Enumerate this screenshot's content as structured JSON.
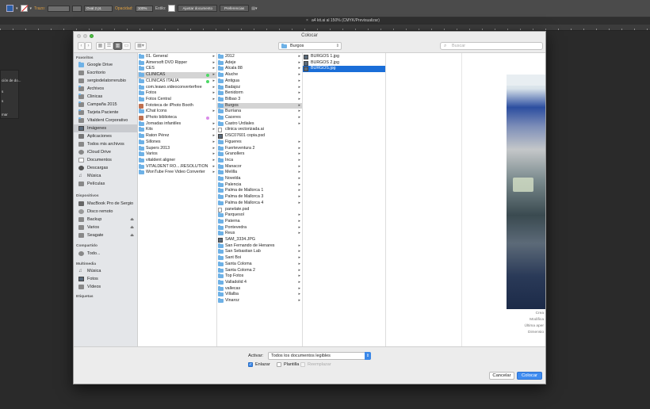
{
  "app_toolbar": {
    "trazo_label": "Trazo:",
    "stroke_profile": "Oval 2 pt.",
    "opacidad_label": "Opacidad:",
    "opacidad_value": "100%",
    "estilo_label": "Estilo:",
    "ajustar_documento": "Ajustar documento",
    "preferencias": "Preferencias"
  },
  "app_window": {
    "doc_tab_title": "a4 kit.ai al 150% (CMYK/Previsualizar)"
  },
  "left_panel": {
    "items": [
      "ción de do...",
      "s",
      "s",
      "mar"
    ]
  },
  "dialog": {
    "title": "Colocar",
    "location": "Burgos",
    "search_placeholder": "Buscar"
  },
  "sidebar": {
    "favoritos_header": "Favoritos",
    "favoritos": [
      {
        "label": "Google Drive",
        "icon": "google-drive-icon"
      },
      {
        "label": "Escritorio",
        "icon": "desktop-icon"
      },
      {
        "label": "sergiodelatorrerubio",
        "icon": "home-icon"
      },
      {
        "label": "Archivos",
        "icon": "folder-icon"
      },
      {
        "label": "Clinicas",
        "icon": "folder-icon"
      },
      {
        "label": "Campaña 2015",
        "icon": "folder-icon"
      },
      {
        "label": "Tarjeta Paciente",
        "icon": "folder-icon"
      },
      {
        "label": "Vitaldent Corporativo",
        "icon": "folder-icon"
      },
      {
        "label": "Imágenes",
        "icon": "pictures-icon"
      },
      {
        "label": "Aplicaciones",
        "icon": "applications-icon"
      },
      {
        "label": "Todos mis archivos",
        "icon": "all-files-icon"
      },
      {
        "label": "iCloud Drive",
        "icon": "cloud-icon"
      },
      {
        "label": "Documentos",
        "icon": "documents-icon"
      },
      {
        "label": "Descargas",
        "icon": "downloads-icon"
      },
      {
        "label": "Música",
        "icon": "music-icon"
      },
      {
        "label": "Películas",
        "icon": "movies-icon"
      }
    ],
    "dispositivos_header": "Dispositivos",
    "dispositivos": [
      {
        "label": "MacBook Pro de Sergio",
        "icon": "laptop-icon"
      },
      {
        "label": "Disco remoto",
        "icon": "disc-icon"
      },
      {
        "label": "Backup",
        "icon": "drive-icon",
        "eject": "⏏"
      },
      {
        "label": "Varios",
        "icon": "drive-icon",
        "eject": "⏏"
      },
      {
        "label": "Seagate",
        "icon": "drive-icon",
        "eject": "⏏"
      }
    ],
    "compartido_header": "Compartido",
    "compartido": [
      {
        "label": "Todo...",
        "icon": "network-icon"
      }
    ],
    "multimedia_header": "Multimedia",
    "multimedia": [
      {
        "label": "Música",
        "icon": "music-icon"
      },
      {
        "label": "Fotos",
        "icon": "photos-icon"
      },
      {
        "label": "Vídeos",
        "icon": "movies-icon"
      }
    ],
    "etiquetas_header": "Etiquetas"
  },
  "column1": [
    {
      "label": "01. General",
      "type": "folder",
      "arrow": true
    },
    {
      "label": "Aimersoft DVD Ripper",
      "type": "folder",
      "arrow": true
    },
    {
      "label": "CES",
      "type": "folder",
      "arrow": true
    },
    {
      "label": "CLINICAS",
      "type": "folder",
      "arrow": true,
      "tag": "#4cd964",
      "selected": true
    },
    {
      "label": "CLINICAS ITALIA",
      "type": "folder",
      "arrow": true,
      "tag": "#4cd964"
    },
    {
      "label": "com.leawo.videoconverterfree",
      "type": "folder",
      "arrow": true
    },
    {
      "label": "Fotos",
      "type": "folder",
      "arrow": true
    },
    {
      "label": "Fotos Central",
      "type": "folder",
      "arrow": true
    },
    {
      "label": "Fototeca de iPhoto Booth",
      "type": "app"
    },
    {
      "label": "iChat Icons",
      "type": "folder",
      "arrow": true
    },
    {
      "label": "iPhoto biblioteca",
      "type": "app",
      "tag": "#d98be8"
    },
    {
      "label": "Jornadas infantiles",
      "type": "folder",
      "arrow": true
    },
    {
      "label": "Kits",
      "type": "folder",
      "arrow": true
    },
    {
      "label": "Raton Pérez",
      "type": "folder",
      "arrow": true
    },
    {
      "label": "Sillones",
      "type": "folder",
      "arrow": true
    },
    {
      "label": "Supers 2013",
      "type": "folder",
      "arrow": true
    },
    {
      "label": "Varios",
      "type": "folder",
      "arrow": true
    },
    {
      "label": "vitaldent aligner",
      "type": "folder",
      "arrow": true
    },
    {
      "label": "VITALDENT RO....RESOLUTION",
      "type": "folder",
      "arrow": true
    },
    {
      "label": "WonTube Free Video Converter",
      "type": "folder",
      "arrow": true
    }
  ],
  "column2": [
    {
      "label": "2012",
      "type": "folder",
      "arrow": true
    },
    {
      "label": "Adeje",
      "type": "folder",
      "arrow": true
    },
    {
      "label": "Alcala 88",
      "type": "folder",
      "arrow": true
    },
    {
      "label": "Aluche",
      "type": "folder",
      "arrow": true
    },
    {
      "label": "Antigua",
      "type": "folder",
      "arrow": true
    },
    {
      "label": "Badajoz",
      "type": "folder",
      "arrow": true
    },
    {
      "label": "Benidorm",
      "type": "folder",
      "arrow": true
    },
    {
      "label": "Bilbao 3",
      "type": "folder",
      "arrow": true
    },
    {
      "label": "Burgos",
      "type": "folder",
      "arrow": true,
      "selected": true
    },
    {
      "label": "Burriana",
      "type": "folder",
      "arrow": true
    },
    {
      "label": "Caceres",
      "type": "folder",
      "arrow": true
    },
    {
      "label": "Castro Urdiales",
      "type": "folder",
      "arrow": true
    },
    {
      "label": "clinica vectorizada.ai",
      "type": "doc"
    },
    {
      "label": "DSC07601 copia.psd",
      "type": "image"
    },
    {
      "label": "Figueres",
      "type": "folder",
      "arrow": true
    },
    {
      "label": "Fuerteventura 2",
      "type": "folder",
      "arrow": true
    },
    {
      "label": "Granollers",
      "type": "folder",
      "arrow": true
    },
    {
      "label": "Inca",
      "type": "folder",
      "arrow": true
    },
    {
      "label": "Manacor",
      "type": "folder",
      "arrow": true
    },
    {
      "label": "Melilla",
      "type": "folder",
      "arrow": true
    },
    {
      "label": "Novelda",
      "type": "folder",
      "arrow": true
    },
    {
      "label": "Palencia",
      "type": "folder",
      "arrow": true
    },
    {
      "label": "Palma de Mallorca 1",
      "type": "folder",
      "arrow": true
    },
    {
      "label": "Palma de Mallorca 3",
      "type": "folder",
      "arrow": true
    },
    {
      "label": "Palma de Mallorca 4",
      "type": "folder",
      "arrow": true
    },
    {
      "label": "panelate.psd",
      "type": "doc"
    },
    {
      "label": "Parquesol",
      "type": "folder",
      "arrow": true
    },
    {
      "label": "Paterna",
      "type": "folder",
      "arrow": true
    },
    {
      "label": "Pontevedra",
      "type": "folder",
      "arrow": true
    },
    {
      "label": "Reus",
      "type": "folder",
      "arrow": true
    },
    {
      "label": "SAM_3334.JPG",
      "type": "image"
    },
    {
      "label": "San Fernando de Henares",
      "type": "folder",
      "arrow": true
    },
    {
      "label": "San Sebastian Lab",
      "type": "folder",
      "arrow": true
    },
    {
      "label": "Sant Boi",
      "type": "folder",
      "arrow": true
    },
    {
      "label": "Santa Coloma",
      "type": "folder",
      "arrow": true
    },
    {
      "label": "Santa Coloma 2",
      "type": "folder",
      "arrow": true
    },
    {
      "label": "Top Fotos",
      "type": "folder",
      "arrow": true
    },
    {
      "label": "Valladolid 4",
      "type": "folder",
      "arrow": true
    },
    {
      "label": "vallecas",
      "type": "folder",
      "arrow": true
    },
    {
      "label": "Villalba",
      "type": "folder",
      "arrow": true
    },
    {
      "label": "Vinaroz",
      "type": "folder",
      "arrow": true
    }
  ],
  "column3": [
    {
      "label": "BURGOS 1.jpg",
      "type": "image"
    },
    {
      "label": "BURGOS 2.jpg",
      "type": "image"
    },
    {
      "label": "BURGOS.jpg",
      "type": "image",
      "selected": true
    }
  ],
  "preview": {
    "meta": [
      "Crea",
      "Modifica",
      "Última aper",
      "Dimensio"
    ]
  },
  "options": {
    "activar_label": "Activar:",
    "activar_value": "Todos los documentos legibles",
    "enlazar_label": "Enlazar",
    "enlazar_checked": true,
    "plantilla_label": "Plantilla",
    "plantilla_checked": false,
    "reemplazar_label": "Reemplazar",
    "reemplazar_enabled": false
  },
  "buttons": {
    "cancel": "Cancelar",
    "place": "Colocar"
  },
  "colors": {
    "accent": "#3f8cf0",
    "selection_blue": "#1a6ed8",
    "folder": "#6eb1e6",
    "tag_green": "#4cd964",
    "tag_purple": "#d98be8"
  }
}
